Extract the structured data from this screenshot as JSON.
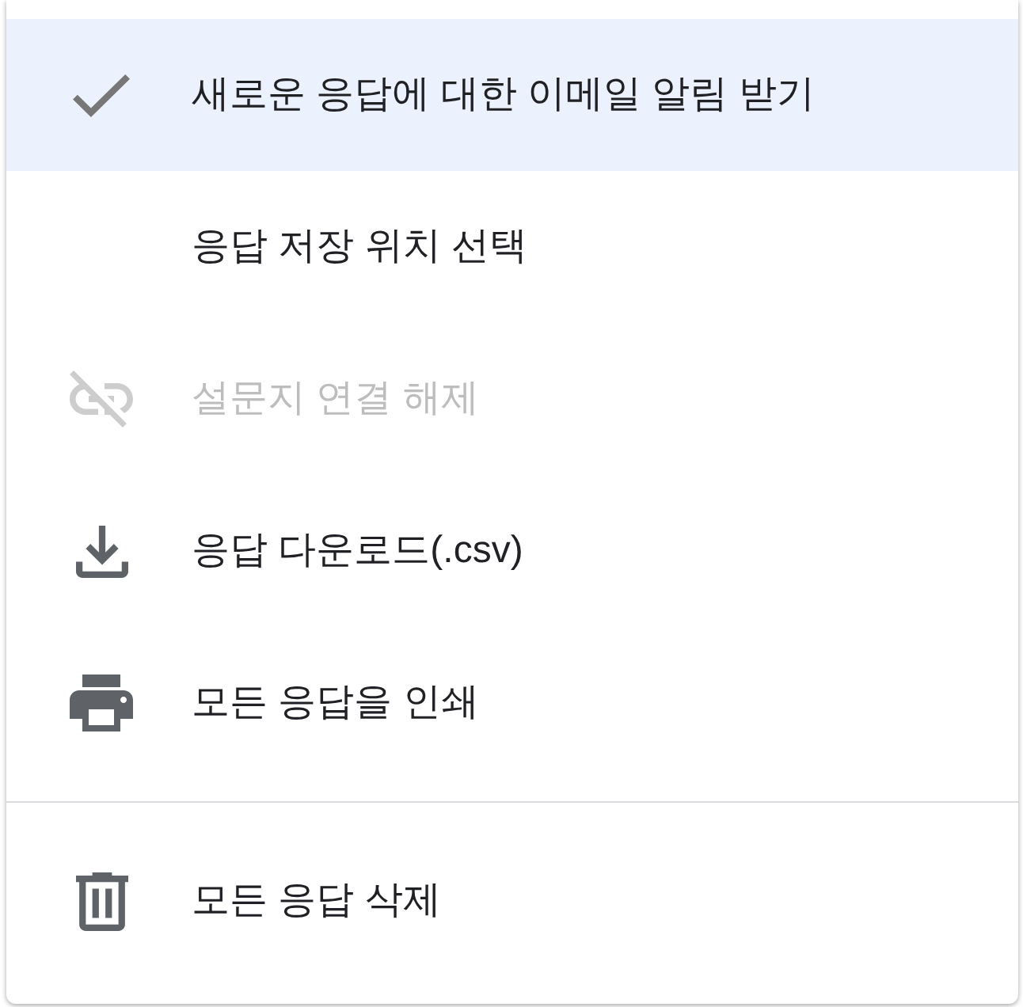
{
  "menu": {
    "groups": [
      {
        "items": [
          {
            "kind": "check",
            "label": "새로운 응답에 대한 이메일 알림 받기",
            "checked": true,
            "highlighted": true,
            "disabled": false
          },
          {
            "kind": "plain",
            "label": "응답 저장 위치 선택",
            "highlighted": false,
            "disabled": false
          },
          {
            "kind": "unlink",
            "label": "설문지 연결 해제",
            "highlighted": false,
            "disabled": true
          },
          {
            "kind": "download",
            "label": "응답 다운로드(.csv)",
            "highlighted": false,
            "disabled": false
          },
          {
            "kind": "print",
            "label": "모든 응답을 인쇄",
            "highlighted": false,
            "disabled": false
          }
        ]
      },
      {
        "items": [
          {
            "kind": "delete",
            "label": "모든 응답 삭제",
            "highlighted": false,
            "disabled": false
          }
        ]
      }
    ]
  }
}
